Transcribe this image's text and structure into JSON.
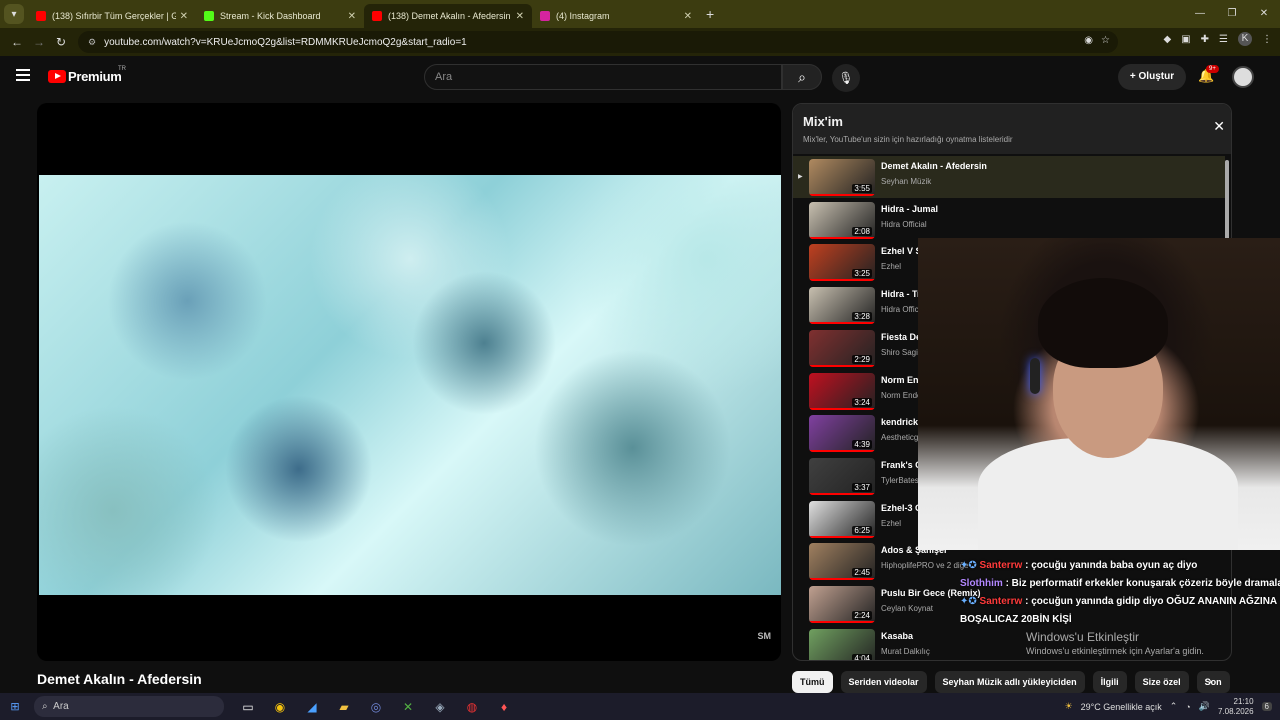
{
  "browser": {
    "tabs": [
      {
        "title": "(138) Sıfırbir Tüm Gerçekler | Gü",
        "favicon_color": "#ff0000"
      },
      {
        "title": "Stream - Kick Dashboard",
        "favicon_color": "#53fc18"
      },
      {
        "title": "(138) Demet Akalın - Afedersin",
        "favicon_color": "#ff0000"
      },
      {
        "title": "(4) Instagram",
        "favicon_color": "#d6249f"
      }
    ],
    "url": "youtube.com/watch?v=KRUeJcmoQ2g&list=RDMMKRUeJcmoQ2g&start_radio=1",
    "profile_initial": "K"
  },
  "youtube": {
    "brand": "Premium",
    "region": "TR",
    "search_placeholder": "Ara",
    "create_label": "Oluştur",
    "notification_badge": "9+"
  },
  "video": {
    "title": "Demet Akalın - Afedersin",
    "watermark": "SM"
  },
  "mix": {
    "title": "Mix'im",
    "subtitle": "Mix'ler, YouTube'un sizin için hazırladığı oynatma listeleridir",
    "items": [
      {
        "title": "Demet Akalın - Afedersin",
        "channel": "Seyhan Müzik",
        "duration": "3:55",
        "color": "#b08a60"
      },
      {
        "title": "Hidra - Jumal",
        "channel": "Hidra Official",
        "duration": "2:08",
        "color": "#c8c0b0"
      },
      {
        "title": "Ezhel V S",
        "channel": "Ezhel",
        "duration": "3:25",
        "color": "#c04020"
      },
      {
        "title": "Hidra - Tr",
        "channel": "Hidra Offic",
        "duration": "3:28",
        "color": "#c8c0b0"
      },
      {
        "title": "Fiesta De",
        "channel": "Shiro Sagis",
        "duration": "2:29",
        "color": "#803030"
      },
      {
        "title": "Norm End",
        "channel": "Norm Ende",
        "duration": "3:24",
        "color": "#c01020"
      },
      {
        "title": "kendrick",
        "channel": "Aestheticg",
        "duration": "4:39",
        "color": "#8040a0"
      },
      {
        "title": "Frank's C",
        "channel": "TylerBates",
        "duration": "3:37",
        "color": "#404040"
      },
      {
        "title": "Ezhel-3 G",
        "channel": "Ezhel",
        "duration": "6:25",
        "color": "#e0e0e0"
      },
      {
        "title": "Ados & Şanışer",
        "channel": "HiphoplifePRO ve 2 diğe",
        "duration": "2:45",
        "color": "#a08060"
      },
      {
        "title": "Puslu Bir Gece (Remix)",
        "channel": "Ceylan Koynat",
        "duration": "2:24",
        "color": "#c0a090"
      },
      {
        "title": "Kasaba",
        "channel": "Murat Dalkılıç",
        "duration": "4:04",
        "color": "#70a060"
      }
    ]
  },
  "chat": {
    "messages": [
      {
        "user": "Santerrw",
        "user_color": "#ff3b3b",
        "text": ": çocuğu yanında baba oyun aç diyo"
      },
      {
        "user": "Slothhim",
        "user_color": "#b388ff",
        "text": ": Biz performatif erkekler konuşarak çözeriz böyle dramaları"
      },
      {
        "user": "Santerrw",
        "user_color": "#ff3b3b",
        "text": ": çocuğun yanında gidip diyo OĞUZ ANANIN AĞZINA"
      },
      {
        "user": "",
        "user_color": "#ffffff",
        "text": "BOŞALICAZ 20BİN KİŞİ"
      }
    ]
  },
  "windows_activation": {
    "title": "Windows'u Etkinleştir",
    "subtitle": "Windows'u etkinleştirmek için Ayarlar'a gidin."
  },
  "chips": [
    "Tümü",
    "Seriden videolar",
    "Seyhan Müzik adlı yükleyiciden",
    "İlgili",
    "Size özel",
    "Son"
  ],
  "taskbar": {
    "search_placeholder": "Ara",
    "weather": "29°C  Genellikle açık",
    "time": "21:10",
    "date": "7.08.2026",
    "notifications": "6"
  }
}
